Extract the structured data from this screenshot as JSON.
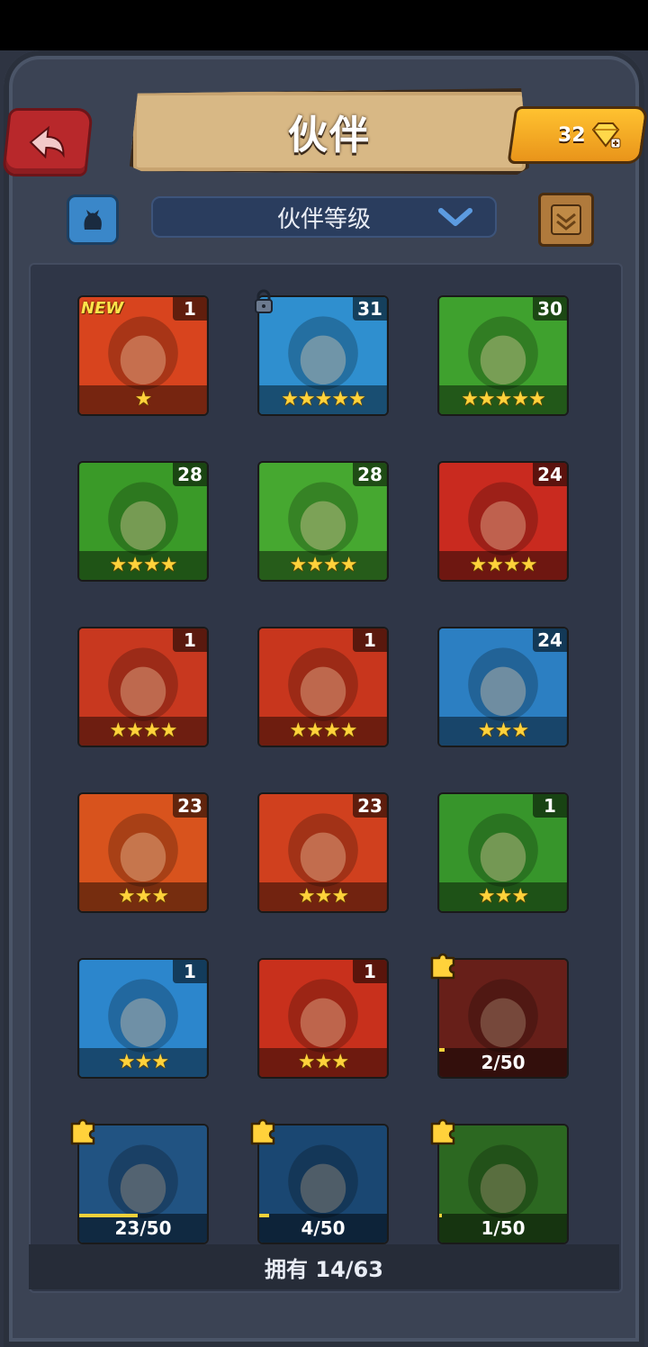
{
  "header": {
    "title": "伙伴",
    "gems": "32",
    "sort_label": "伙伴等级"
  },
  "icons": {
    "back": "back-arrow-icon",
    "gem": "gem-plus-icon",
    "filter": "cat-filter-icon",
    "dropdown": "chevron-down-icon",
    "map": "map-scroll-icon",
    "lock": "lock-icon",
    "fragment": "puzzle-piece-icon"
  },
  "companions": [
    {
      "level": "1",
      "stars": "★",
      "new": "NEW",
      "bg": "#d8441e"
    },
    {
      "level": "31",
      "stars": "★★★★★",
      "bg": "#2f8fcf",
      "locked": true
    },
    {
      "level": "30",
      "stars": "★★★★★",
      "bg": "#3fa12e"
    },
    {
      "level": "28",
      "stars": "★★★★",
      "bg": "#3a9a28"
    },
    {
      "level": "28",
      "stars": "★★★★",
      "bg": "#46a830"
    },
    {
      "level": "24",
      "stars": "★★★★",
      "bg": "#c92a1f"
    },
    {
      "level": "1",
      "stars": "★★★★",
      "bg": "#c8381f"
    },
    {
      "level": "1",
      "stars": "★★★★",
      "bg": "#c8361d"
    },
    {
      "level": "24",
      "stars": "★★★",
      "bg": "#2c7fc2"
    },
    {
      "level": "23",
      "stars": "★★★",
      "bg": "#d8531d"
    },
    {
      "level": "23",
      "stars": "★★★",
      "bg": "#d0401e"
    },
    {
      "level": "1",
      "stars": "★★★",
      "bg": "#37952b"
    },
    {
      "level": "1",
      "stars": "★★★",
      "bg": "#2c86cc"
    },
    {
      "level": "1",
      "stars": "★★★",
      "bg": "#c8301c"
    },
    {
      "fragments": "2/50",
      "progress": 0.04,
      "bg": "#8a2a22"
    },
    {
      "fragments": "23/50",
      "progress": 0.46,
      "bg": "#2d6fae"
    },
    {
      "fragments": "4/50",
      "progress": 0.08,
      "bg": "#235f98"
    },
    {
      "fragments": "1/50",
      "progress": 0.02,
      "bg": "#3b8b2c"
    }
  ],
  "footer": {
    "owned": "拥有 14/63"
  }
}
